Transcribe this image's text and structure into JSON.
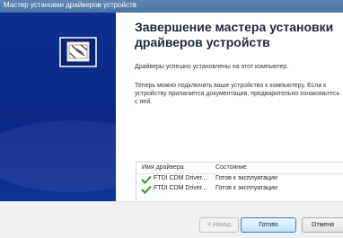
{
  "window": {
    "title": "Мастер установки драйверов устройств"
  },
  "wizard": {
    "heading": "Завершение мастера установки драйверов устройств",
    "message_installed": "Драйверы успешно установлены на этот компьютер.",
    "message_connect": "Теперь можно подключить ваше устройство к компьютеру. Если к устройству прилагается документация, предварительно ознакомьтесь с ней."
  },
  "drivers_table": {
    "columns": [
      "Имя драйвера",
      "Состояние"
    ],
    "rows": [
      {
        "name": "FTDI CDM Driver...",
        "status": "Готов к эксплуатации"
      },
      {
        "name": "FTDI CDM Driver...",
        "status": "Готов к эксплуатации"
      }
    ]
  },
  "buttons": {
    "back": "< Назад",
    "finish": "Готово",
    "cancel": "Отмена"
  },
  "colors": {
    "side_panel": "#0d2f8f",
    "check": "#2a9a2a",
    "heading": "#1c2a3c"
  }
}
